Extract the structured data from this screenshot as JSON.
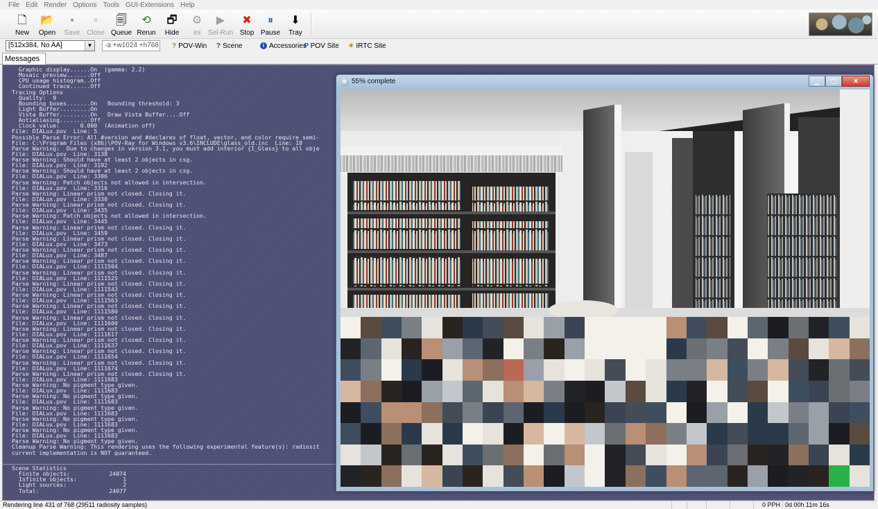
{
  "menu": [
    "File",
    "Edit",
    "Render",
    "Options",
    "Tools",
    "GUI-Extensions",
    "Help"
  ],
  "toolbar": [
    {
      "label": "New",
      "icon": "new-file-icon",
      "glyph": "🗋",
      "enabled": true
    },
    {
      "label": "Open",
      "icon": "open-folder-icon",
      "glyph": "📂",
      "enabled": true
    },
    {
      "label": "Save",
      "icon": "save-disk-icon",
      "glyph": "▪",
      "enabled": false
    },
    {
      "label": "Close",
      "icon": "close-file-icon",
      "glyph": "▫",
      "enabled": false
    },
    {
      "label": "Queue",
      "icon": "queue-icon",
      "glyph": "🗐",
      "enabled": true
    },
    {
      "label": "Rerun",
      "icon": "rerun-icon",
      "glyph": "⟲",
      "enabled": true
    },
    {
      "label": "Hide",
      "icon": "hide-window-icon",
      "glyph": "🗗",
      "enabled": true
    },
    {
      "label": "Ini",
      "icon": "ini-icon",
      "glyph": "⚙",
      "enabled": false
    },
    {
      "label": "Sel-Run",
      "icon": "sel-run-icon",
      "glyph": "▶",
      "enabled": false
    },
    {
      "label": "Stop",
      "icon": "stop-icon",
      "glyph": "✖",
      "enabled": true
    },
    {
      "label": "Pause",
      "icon": "pause-icon",
      "glyph": "⏸",
      "enabled": true
    },
    {
      "label": "Tray",
      "icon": "tray-icon",
      "glyph": "⬇",
      "enabled": true
    }
  ],
  "resolution": {
    "selected": "[512x384, No AA]"
  },
  "command_line": {
    "value": "-a +w1024 +h768"
  },
  "links": [
    {
      "label": "POV-Win",
      "icon": "help-question-icon"
    },
    {
      "label": "Scene",
      "icon": "scene-question-icon"
    },
    {
      "label": "Accessories",
      "icon": "info-icon"
    },
    {
      "label": "POV Site",
      "icon": "pov-site-icon"
    },
    {
      "label": "IRTC Site",
      "icon": "irtc-site-icon"
    }
  ],
  "tabs": {
    "messages": "Messages"
  },
  "messages": [
    "  Graphic display......On  (gamma: 2.2)",
    "  Mosaic preview.......Off",
    "  CPU usage histogram..Off",
    "  Continued trace......Off",
    "Tracing Options",
    "  Quality:  9",
    "  Bounding boxes.......On   Bounding threshold: 3",
    "  Light Buffer.........On",
    "  Vista Buffer.........On   Draw Vista Buffer....Off",
    "  Antialiasing.........Off",
    "  Clock value:      0.000  (Animation off)",
    "File: DIALux.pov  Line: 5",
    "Possible Parse Error: All #version and #declares of float, vector, and color require semi-",
    "File: C:\\Program Files (x86)\\POV-Ray for Windows v3.6\\INCLUDE\\glass_old.inc  Line: 18",
    "Parse Warning:  Due to changes in version 3.1, you must add interior {I_Glass} to all obje",
    "File: DIALux.pov  Line: 3138",
    "Parse Warning: Should have at least 2 objects in csg.",
    "File: DIALux.pov  Line: 3192",
    "Parse Warning: Should have at least 2 objects in csg.",
    "File: DIALux.pov  Line: 3306",
    "Parse Warning: Patch objects not allowed in intersection.",
    "File: DIALux.pov  Line: 3316",
    "Parse Warning: Linear prism not closed. Closing it.",
    "File: DIALux.pov  Line: 3330",
    "Parse Warning: Linear prism not closed. Closing it.",
    "File: DIALux.pov  Line: 3435",
    "Parse Warning: Patch objects not allowed in intersection.",
    "File: DIALux.pov  Line: 3445",
    "Parse Warning: Linear prism not closed. Closing it.",
    "File: DIALux.pov  Line: 3459",
    "Parse Warning: Linear prism not closed. Closing it.",
    "File: DIALux.pov  Line: 3473",
    "Parse Warning: Linear prism not closed. Closing it.",
    "File: DIALux.pov  Line: 3487",
    "Parse Warning: Linear prism not closed. Closing it.",
    "File: DIALux.pov  Line: 1111504",
    "Parse Warning: Linear prism not closed. Closing it.",
    "File: DIALux.pov  Line: 1111525",
    "Parse Warning: Linear prism not closed. Closing it.",
    "File: DIALux.pov  Line: 1111543",
    "Parse Warning: Linear prism not closed. Closing it.",
    "File: DIALux.pov  Line: 1111563",
    "Parse Warning: Linear prism not closed. Closing it.",
    "File: DIALux.pov  Line: 1111580",
    "Parse Warning: Linear prism not closed. Closing it.",
    "File: DIALux.pov  Line: 1111600",
    "Parse Warning: Linear prism not closed. Closing it.",
    "File: DIALux.pov  Line: 1111617",
    "Parse Warning: Linear prism not closed. Closing it.",
    "File: DIALux.pov  Line: 1111637",
    "Parse Warning: Linear prism not closed. Closing it.",
    "File: DIALux.pov  Line: 1111654",
    "Parse Warning: Linear prism not closed. Closing it.",
    "File: DIALux.pov  Line: 1111674",
    "Parse Warning: Linear prism not closed. Closing it.",
    "File: DIALux.pov  Line: 1111683",
    "Parse Warning: No pigment type given.",
    "File: DIALux.pov  Line: 1111683",
    "Parse Warning: No pigment type given.",
    "File: DIALux.pov  Line: 1111683",
    "Parse Warning: No pigment type given.",
    "File: DIALux.pov  Line: 1111683",
    "Parse Warning: No pigment type given.",
    "File: DIALux.pov  Line: 1111683",
    "Parse Warning: No pigment type given.",
    "File: DIALux.pov  Line: 1111683",
    "Parse Warning: No pigment type given.",
    "Cleanup Parse Warning: This rendering uses the following experimental feature(s): radiosit",
    "current implementation is NOT guaranteed."
  ],
  "scene_stats": {
    "heading": "Scene Statistics",
    "rows": [
      {
        "label": "Finite objects:",
        "value": "24074"
      },
      {
        "label": "Infinite objects:",
        "value": "1"
      },
      {
        "label": "Light sources:",
        "value": "2"
      },
      {
        "label": "Total:",
        "value": "24077"
      }
    ]
  },
  "render_window": {
    "title": "55% complete",
    "progress_fraction": 0.55
  },
  "status": {
    "main": "Rendering line 431 of 768 (29511 radiosity samples)",
    "pph": "0 PPH",
    "elapsed": "0d 00h 11m 16s"
  },
  "colors": {
    "message_bg": "#4f5076",
    "message_text": "#e8e8f3",
    "window_frame": "#a9c2da",
    "close_button": "#c4402c"
  }
}
